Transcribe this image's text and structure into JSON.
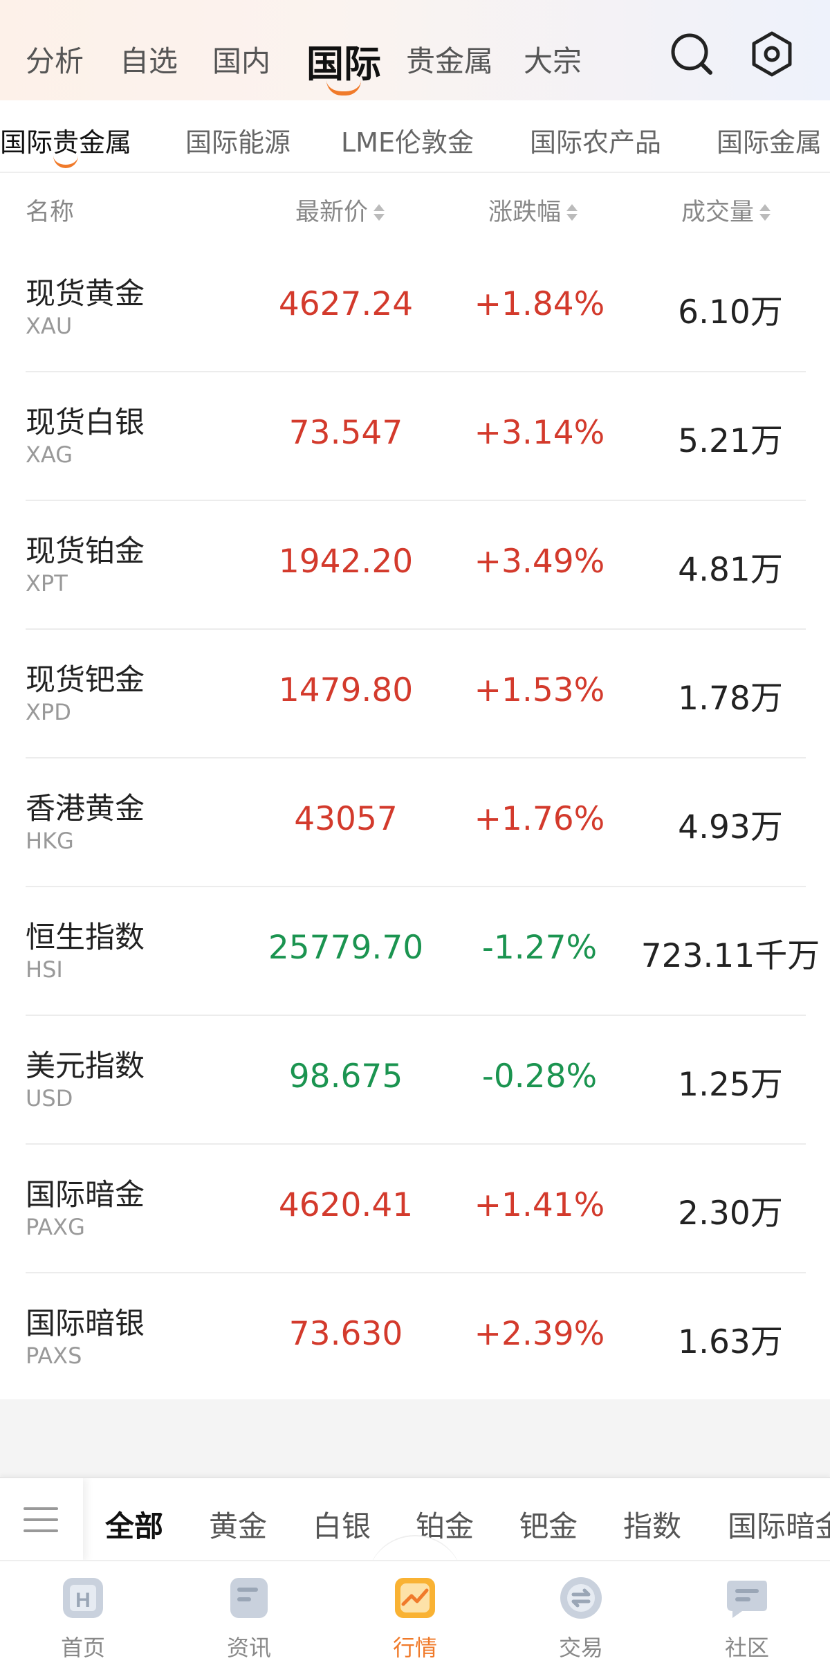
{
  "top_tabs": [
    {
      "label": "分析",
      "active": false
    },
    {
      "label": "自选",
      "active": false
    },
    {
      "label": "国内",
      "active": false
    },
    {
      "label": "国际",
      "active": true
    },
    {
      "label": "贵金属",
      "active": false
    },
    {
      "label": "大宗",
      "active": false
    }
  ],
  "top_icons": [
    "search-icon",
    "settings-icon"
  ],
  "sub_tabs": [
    {
      "label": "国际贵金属",
      "active": true
    },
    {
      "label": "国际能源",
      "active": false
    },
    {
      "label": "LME伦敦金",
      "active": false
    },
    {
      "label": "国际农产品",
      "active": false
    },
    {
      "label": "国际金属",
      "active": false
    }
  ],
  "columns": {
    "name": "名称",
    "price": "最新价",
    "change": "涨跌幅",
    "volume": "成交量"
  },
  "rows": [
    {
      "name": "现货黄金",
      "code": "XAU",
      "price": "4627.24",
      "change": "+1.84%",
      "volume": "6.10万",
      "direction": "up"
    },
    {
      "name": "现货白银",
      "code": "XAG",
      "price": "73.547",
      "change": "+3.14%",
      "volume": "5.21万",
      "direction": "up"
    },
    {
      "name": "现货铂金",
      "code": "XPT",
      "price": "1942.20",
      "change": "+3.49%",
      "volume": "4.81万",
      "direction": "up"
    },
    {
      "name": "现货钯金",
      "code": "XPD",
      "price": "1479.80",
      "change": "+1.53%",
      "volume": "1.78万",
      "direction": "up"
    },
    {
      "name": "香港黄金",
      "code": "HKG",
      "price": "43057",
      "change": "+1.76%",
      "volume": "4.93万",
      "direction": "up"
    },
    {
      "name": "恒生指数",
      "code": "HSI",
      "price": "25779.70",
      "change": "-1.27%",
      "volume": "723.11千万",
      "direction": "down"
    },
    {
      "name": "美元指数",
      "code": "USD",
      "price": "98.675",
      "change": "-0.28%",
      "volume": "1.25万",
      "direction": "down"
    },
    {
      "name": "国际暗金",
      "code": "PAXG",
      "price": "4620.41",
      "change": "+1.41%",
      "volume": "2.30万",
      "direction": "up"
    },
    {
      "name": "国际暗银",
      "code": "PAXS",
      "price": "73.630",
      "change": "+2.39%",
      "volume": "1.63万",
      "direction": "up"
    }
  ],
  "filters": [
    {
      "label": "全部",
      "active": true
    },
    {
      "label": "黄金",
      "active": false
    },
    {
      "label": "白银",
      "active": false
    },
    {
      "label": "铂金",
      "active": false
    },
    {
      "label": "钯金",
      "active": false
    },
    {
      "label": "指数",
      "active": false
    },
    {
      "label": "国际暗金",
      "active": false
    }
  ],
  "bottom_nav": [
    {
      "label": "首页",
      "icon": "home-icon",
      "active": false
    },
    {
      "label": "资讯",
      "icon": "news-icon",
      "active": false
    },
    {
      "label": "行情",
      "icon": "market-chart-icon",
      "active": true
    },
    {
      "label": "交易",
      "icon": "trade-icon",
      "active": false
    },
    {
      "label": "社区",
      "icon": "community-icon",
      "active": false
    }
  ],
  "colors": {
    "up": "#d33a2c",
    "down": "#1b9450",
    "accent": "#f07a2a"
  }
}
